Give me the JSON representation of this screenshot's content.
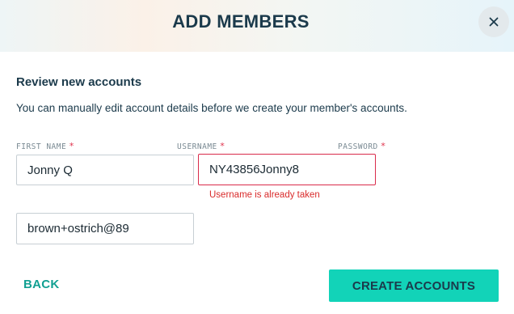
{
  "modal": {
    "title": "ADD MEMBERS",
    "close_icon": "close-icon"
  },
  "review": {
    "heading": "Review new accounts",
    "description": "You can manually edit account details before we create your member's accounts."
  },
  "fields": {
    "first_name_label": "FIRST NAME",
    "username_label": "USERNAME",
    "password_label": "PASSWORD",
    "required_marker": "*",
    "first_name_value": "Jonny Q",
    "username_value": "NY43856Jonny8",
    "username_error": "Username is already taken",
    "password_value": "brown+ostrich@89"
  },
  "footer": {
    "back_label": "BACK",
    "create_label": "CREATE ACCOUNTS"
  },
  "colors": {
    "accent": "#12d3b8",
    "back_text": "#12a092",
    "error": "#d92b4b",
    "heading": "#1b3a4b"
  }
}
